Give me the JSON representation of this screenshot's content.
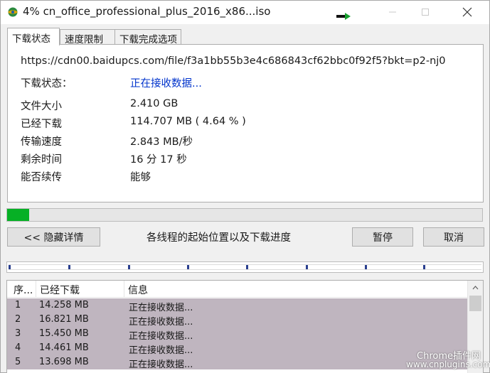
{
  "window": {
    "title": "4% cn_office_professional_plus_2016_x86...iso"
  },
  "tabs": [
    {
      "label": "下载状态"
    },
    {
      "label": "速度限制"
    },
    {
      "label": "下载完成选项"
    }
  ],
  "status": {
    "url": "https://cdn00.baidupcs.com/file/f3a1bb55b3e4c686843cf62bbc0f92f5?bkt=p2-nj0",
    "rows": [
      {
        "label": "下载状态：",
        "value": "正在接收数据..."
      },
      {
        "label": "文件大小",
        "value": "2.410  GB"
      },
      {
        "label": "已经下载",
        "value": "114.707  MB  ( 4.64 % )"
      },
      {
        "label": "传输速度",
        "value": "2.843  MB/秒"
      },
      {
        "label": "剩余时间",
        "value": "16 分 17 秒"
      },
      {
        "label": "能否续传",
        "value": "能够"
      }
    ]
  },
  "progress": {
    "percent": 4.64
  },
  "buttons": {
    "hide_details": "<< 隐藏详情",
    "pause": "暂停",
    "cancel": "取消"
  },
  "threads_caption": "各线程的起始位置以及下载进度",
  "thread_markers": [
    0,
    0.127,
    0.253,
    0.378,
    0.503,
    0.628,
    0.753,
    0.877
  ],
  "table": {
    "headers": [
      "序...",
      "已经下载",
      "信息"
    ],
    "rows": [
      [
        "1",
        "14.258  MB",
        "正在接收数据..."
      ],
      [
        "2",
        "16.821  MB",
        "正在接收数据..."
      ],
      [
        "3",
        "15.450  MB",
        "正在接收数据..."
      ],
      [
        "4",
        "14.461  MB",
        "正在接收数据..."
      ],
      [
        "5",
        "13.698  MB",
        "正在接收数据..."
      ]
    ]
  },
  "watermark": {
    "line1": "Chrome插件网",
    "line2": "www.cnplugins.com"
  },
  "colors": {
    "progress_fill": "#06b025",
    "link": "#0033cc",
    "selected_row": "#bfb5bf",
    "thread_marker": "#2a3f8f"
  }
}
